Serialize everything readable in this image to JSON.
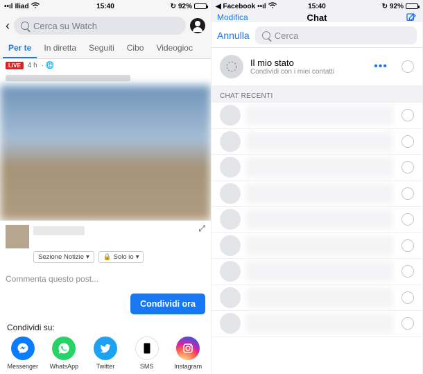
{
  "left": {
    "status": {
      "carrier": "Iliad",
      "signal_icon": "signal-icon",
      "wifi_icon": "wifi-icon",
      "time": "15:40",
      "refresh_icon": "sync-icon",
      "battery_pct": "92%"
    },
    "header": {
      "search_placeholder": "Cerca su Watch"
    },
    "tabs": [
      "Per te",
      "In diretta",
      "Seguiti",
      "Cibo",
      "Videogioc"
    ],
    "tabs_active_index": 0,
    "post": {
      "live_label": "LIVE",
      "time_text": "4 h",
      "globe_icon": "globe-icon"
    },
    "share": {
      "section_label": "Sezione Notizie",
      "privacy_label": "Solo io",
      "comment_placeholder": "Commenta questo post...",
      "share_button": "Condividi ora",
      "share_on_label": "Condividi su:",
      "apps": [
        {
          "name": "Messenger",
          "key": "msgr"
        },
        {
          "name": "WhatsApp",
          "key": "wa"
        },
        {
          "name": "Twitter",
          "key": "tw"
        },
        {
          "name": "SMS",
          "key": "sms"
        },
        {
          "name": "Instagram",
          "key": "ig"
        }
      ]
    }
  },
  "right": {
    "status": {
      "back_app": "Facebook",
      "time": "15:40",
      "battery_pct": "92%"
    },
    "peek": {
      "title": "Chat",
      "edit": "Modifica"
    },
    "modal": {
      "cancel": "Annulla",
      "search_placeholder": "Cerca"
    },
    "my_status": {
      "title": "Il mio stato",
      "subtitle": "Condividi con i miei contatti"
    },
    "section_recent": "CHAT RECENTI",
    "recent_count": 9
  }
}
